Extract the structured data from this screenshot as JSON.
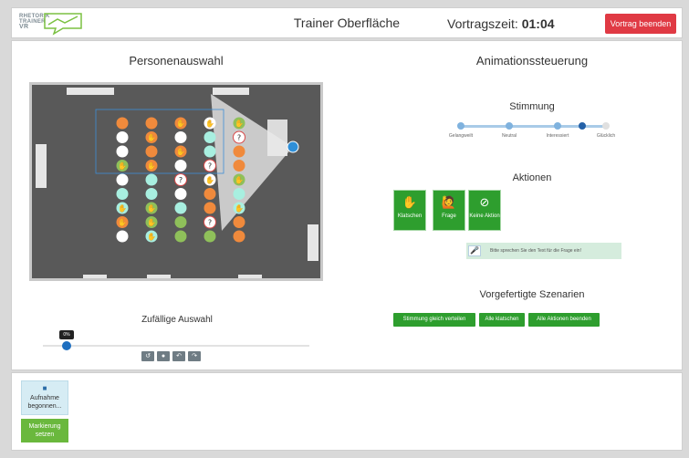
{
  "header": {
    "logo_lines": [
      "RHETORIK",
      "TRAINER",
      "VR"
    ],
    "title": "Trainer Oberfläche",
    "time_label": "Vortragszeit:",
    "time_value": "01:04",
    "end_button": "Vortrag beenden"
  },
  "left": {
    "heading": "Personenauswahl",
    "random_title": "Zufällige Auswahl",
    "slider_value": "0%",
    "slider_fraction": 0.09,
    "tool_icons": [
      "reset-icon",
      "crowd-icon",
      "undo-icon",
      "redo-icon"
    ]
  },
  "right": {
    "heading": "Animationssteuerung",
    "mood": {
      "heading": "Stimmung",
      "levels": [
        "Gelangweilt",
        "Neutral",
        "Interessiert",
        "Glücklich"
      ],
      "selected_index": 2
    },
    "actions": {
      "heading": "Aktionen",
      "buttons": [
        {
          "icon": "clap-icon",
          "label": "Klatschen"
        },
        {
          "icon": "question-person-icon",
          "label": "Frage"
        },
        {
          "icon": "no-action-icon",
          "label": "Keine Aktion"
        }
      ],
      "speak_prompt": "Bitte sprechen Sie den Text für die Frage ein!"
    },
    "scenarios": {
      "heading": "Vorgefertigte Szenarien",
      "buttons": [
        "Stimmung gleich verteilen",
        "Alle klatschen",
        "Alle Aktionen beenden"
      ]
    }
  },
  "bottom": {
    "record_button": "Aufnahme begonnen...",
    "mark_button": "Markierung setzen"
  },
  "colors": {
    "accent_green": "#2e9e2e",
    "end_red": "#e03a44",
    "mood_blue": "#2461a8",
    "seat_orange": "#f08a3c",
    "seat_white": "#ffffff",
    "seat_cyan": "#a8efe0",
    "seat_green": "#8fc05a"
  }
}
